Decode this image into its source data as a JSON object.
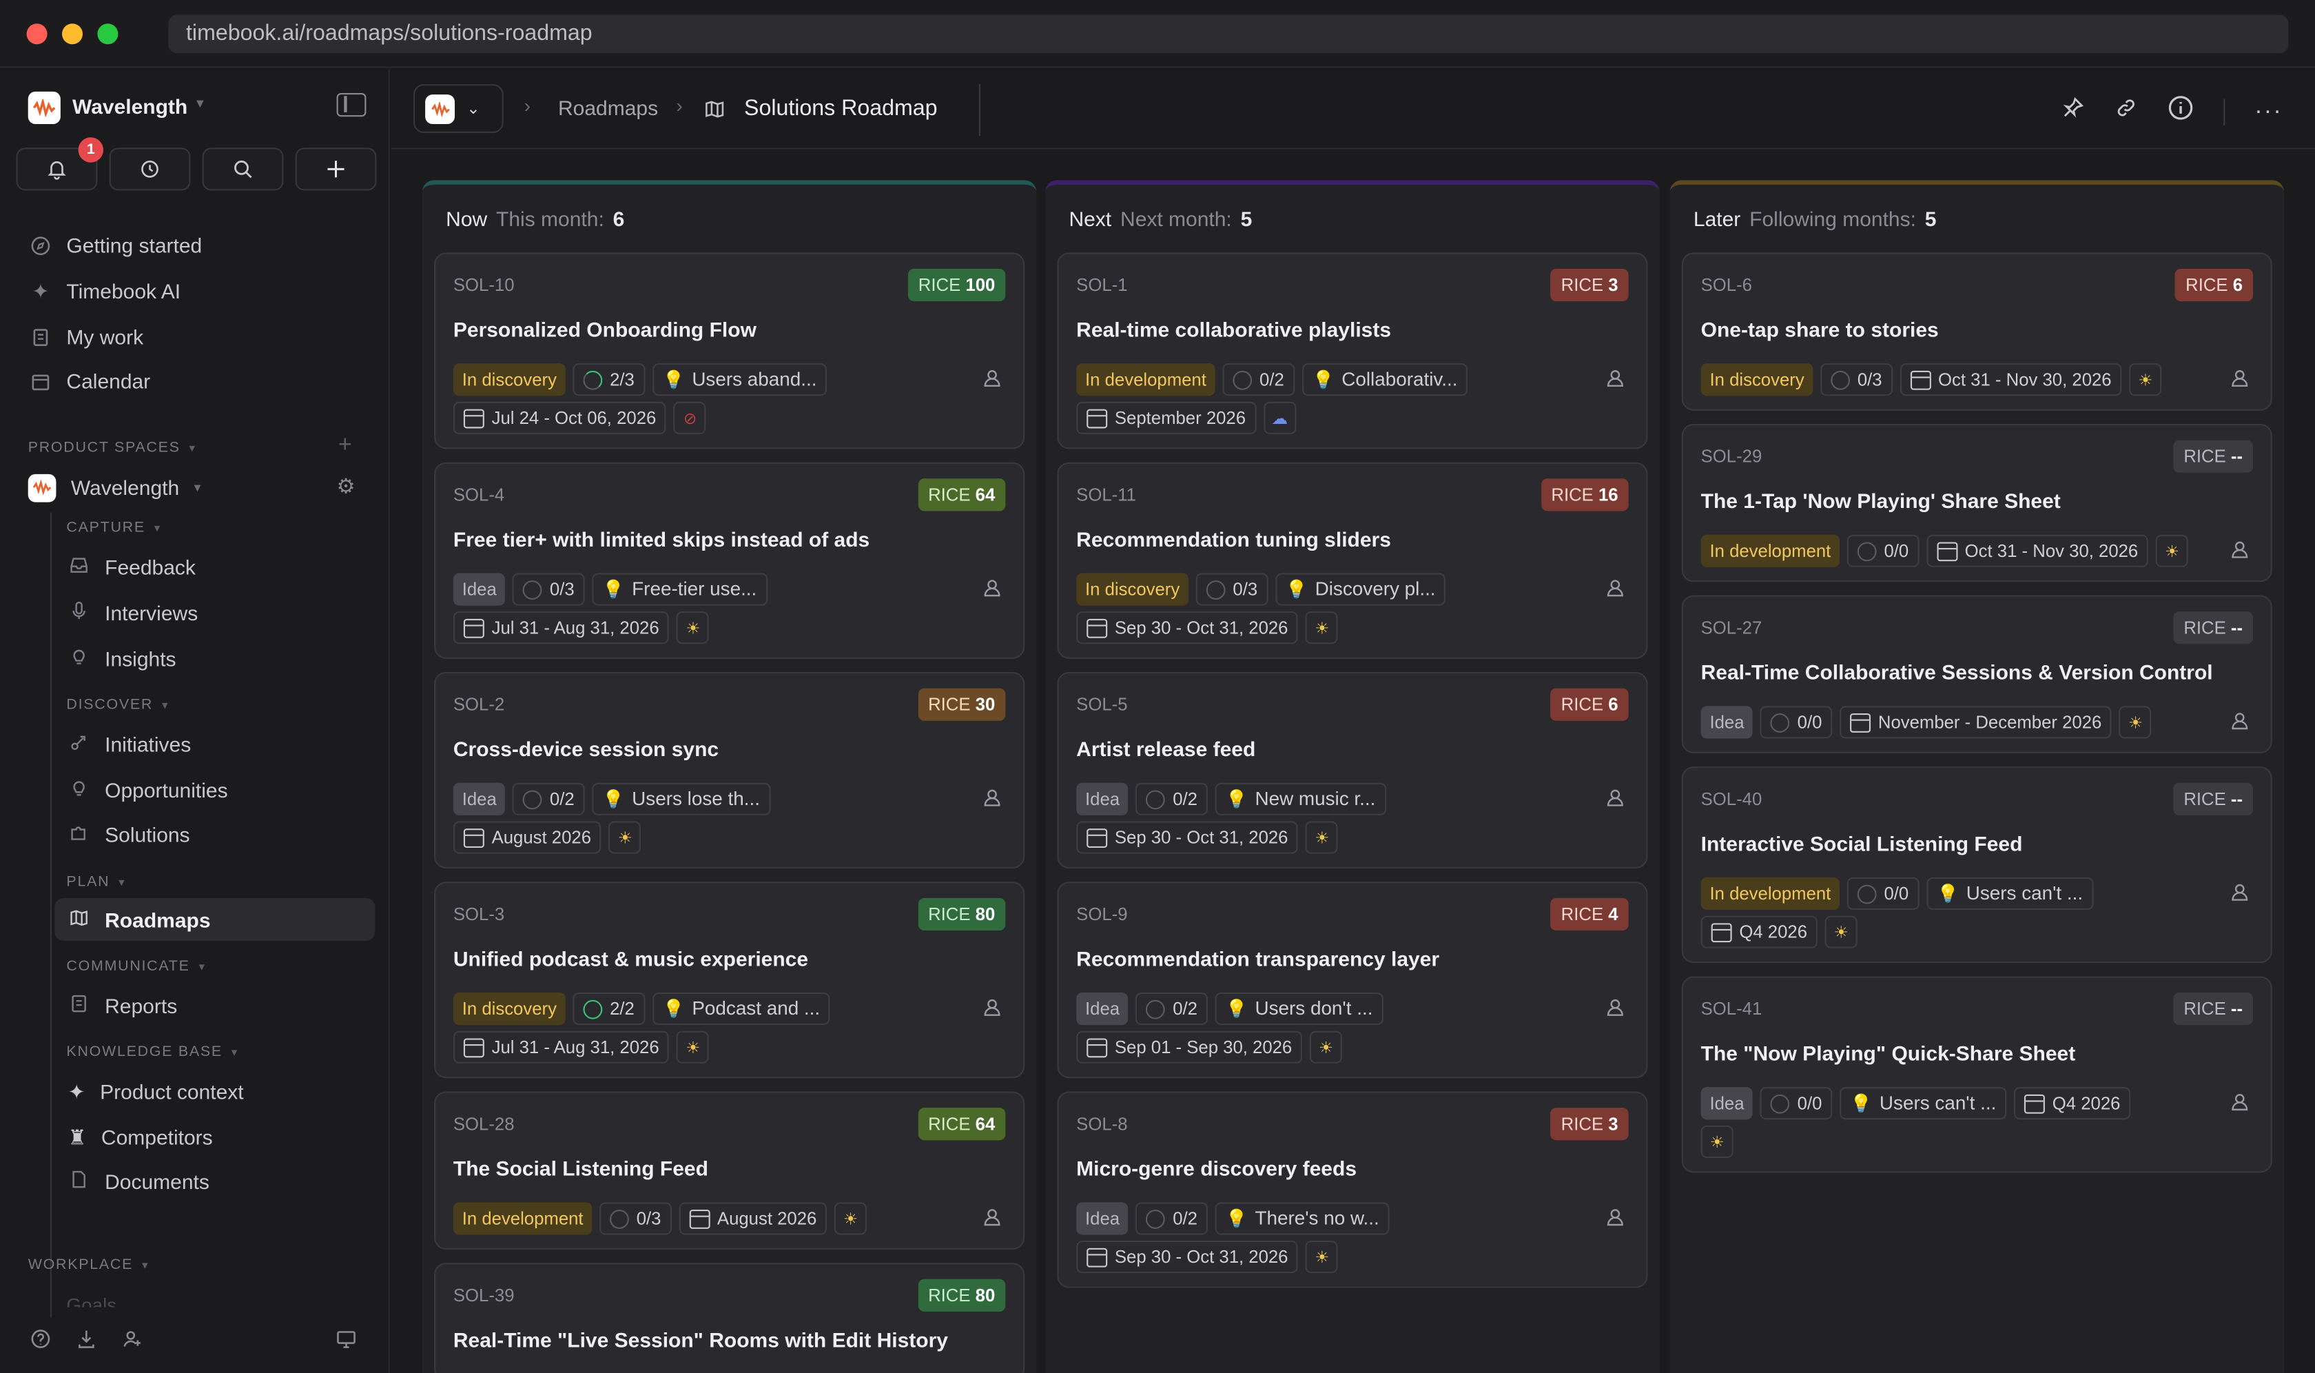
{
  "browser": {
    "url": "timebook.ai/roadmaps/solutions-roadmap"
  },
  "sidebar": {
    "workspace": "Wavelength",
    "notifications_count": "1",
    "nav": [
      {
        "label": "Getting started",
        "icon": "compass-icon"
      },
      {
        "label": "Timebook AI",
        "icon": "sparkle-icon"
      },
      {
        "label": "My work",
        "icon": "clipboard-icon"
      },
      {
        "label": "Calendar",
        "icon": "calendar-icon"
      }
    ],
    "product_spaces_label": "PRODUCT SPACES",
    "space_name": "Wavelength",
    "capture_label": "CAPTURE",
    "capture": [
      "Feedback",
      "Interviews",
      "Insights"
    ],
    "discover_label": "DISCOVER",
    "discover": [
      "Initiatives",
      "Opportunities",
      "Solutions"
    ],
    "plan_label": "PLAN",
    "plan": [
      "Roadmaps"
    ],
    "communicate_label": "COMMUNICATE",
    "communicate": [
      "Reports"
    ],
    "knowledge_label": "KNOWLEDGE BASE",
    "knowledge": [
      "Product context",
      "Competitors",
      "Documents"
    ],
    "workplace_label": "WORKPLACE",
    "workplace_partial": "Goals"
  },
  "header": {
    "crumb_roadmaps": "Roadmaps",
    "title": "Solutions Roadmap"
  },
  "columns": [
    {
      "name": "Now",
      "sub": "This month:",
      "count": "6",
      "accent": "#1f5a55",
      "cards": [
        {
          "id": "SOL-10",
          "rice": "100",
          "rice_color": "green",
          "title": "Personalized Onboarding Flow",
          "status": "In discovery",
          "status_type": "disc",
          "progress": "2/3",
          "prog_type": "partial",
          "opp": "Users aband...",
          "date": "Jul 24 - Oct 06, 2026",
          "extra": "blocked"
        },
        {
          "id": "SOL-4",
          "rice": "64",
          "rice_color": "olive",
          "title": "Free tier+ with limited skips instead of ads",
          "status": "Idea",
          "status_type": "idea",
          "progress": "0/3",
          "prog_type": "empty",
          "opp": "Free-tier use...",
          "date": "Jul 31 - Aug 31, 2026",
          "extra": "sun"
        },
        {
          "id": "SOL-2",
          "rice": "30",
          "rice_color": "amber",
          "title": "Cross-device session sync",
          "status": "Idea",
          "status_type": "idea",
          "progress": "0/2",
          "prog_type": "empty",
          "opp": "Users lose th...",
          "date": "August 2026",
          "extra": "sun"
        },
        {
          "id": "SOL-3",
          "rice": "80",
          "rice_color": "green",
          "title": "Unified podcast & music experience",
          "status": "In discovery",
          "status_type": "disc",
          "progress": "2/2",
          "prog_type": "full",
          "opp": "Podcast and ...",
          "date": "Jul 31 - Aug 31, 2026",
          "extra": "sun"
        },
        {
          "id": "SOL-28",
          "rice": "64",
          "rice_color": "olive",
          "title": "The Social Listening Feed",
          "status": "In development",
          "status_type": "dev",
          "progress": "0/3",
          "prog_type": "empty",
          "opp": "",
          "date": "August 2026",
          "extra": "sun"
        },
        {
          "id": "SOL-39",
          "rice": "80",
          "rice_color": "green",
          "title": "Real-Time \"Live Session\" Rooms with Edit History",
          "status": "",
          "status_type": "",
          "progress": "",
          "prog_type": "",
          "opp": "",
          "date": "",
          "extra": ""
        }
      ]
    },
    {
      "name": "Next",
      "sub": "Next month:",
      "count": "5",
      "accent": "#3e1f6b",
      "cards": [
        {
          "id": "SOL-1",
          "rice": "3",
          "rice_color": "red",
          "title": "Real-time collaborative playlists",
          "status": "In development",
          "status_type": "dev",
          "progress": "0/2",
          "prog_type": "empty",
          "opp": "Collaborativ...",
          "date": "September 2026",
          "extra": "cloud"
        },
        {
          "id": "SOL-11",
          "rice": "16",
          "rice_color": "red",
          "title": "Recommendation tuning sliders",
          "status": "In discovery",
          "status_type": "disc",
          "progress": "0/3",
          "prog_type": "empty",
          "opp": "Discovery pl...",
          "date": "Sep 30 - Oct 31, 2026",
          "extra": "sun"
        },
        {
          "id": "SOL-5",
          "rice": "6",
          "rice_color": "red",
          "title": "Artist release feed",
          "status": "Idea",
          "status_type": "idea",
          "progress": "0/2",
          "prog_type": "empty",
          "opp": "New music r...",
          "date": "Sep 30 - Oct 31, 2026",
          "extra": "sun"
        },
        {
          "id": "SOL-9",
          "rice": "4",
          "rice_color": "red",
          "title": "Recommendation transparency layer",
          "status": "Idea",
          "status_type": "idea",
          "progress": "0/2",
          "prog_type": "empty",
          "opp": "Users don't ...",
          "date": "Sep 01 - Sep 30, 2026",
          "extra": "sun"
        },
        {
          "id": "SOL-8",
          "rice": "3",
          "rice_color": "red",
          "title": "Micro-genre discovery feeds",
          "status": "Idea",
          "status_type": "idea",
          "progress": "0/2",
          "prog_type": "empty",
          "opp": "There's no w...",
          "date": "Sep 30 - Oct 31, 2026",
          "extra": "sun"
        }
      ]
    },
    {
      "name": "Later",
      "sub": "Following months:",
      "count": "5",
      "accent": "#5a4a1c",
      "cards": [
        {
          "id": "SOL-6",
          "rice": "6",
          "rice_color": "red",
          "title": "One-tap share to stories",
          "status": "In discovery",
          "status_type": "disc",
          "progress": "0/3",
          "prog_type": "empty",
          "opp": "",
          "date": "Oct 31 - Nov 30, 2026",
          "extra": "sun"
        },
        {
          "id": "SOL-29",
          "rice": "--",
          "rice_color": "gray",
          "title": "The 1-Tap 'Now Playing' Share Sheet",
          "status": "In development",
          "status_type": "dev",
          "progress": "0/0",
          "prog_type": "empty",
          "opp": "",
          "date": "Oct 31 - Nov 30, 2026",
          "extra": "sun"
        },
        {
          "id": "SOL-27",
          "rice": "--",
          "rice_color": "gray",
          "title": "Real-Time Collaborative Sessions & Version Control",
          "status": "Idea",
          "status_type": "idea",
          "progress": "0/0",
          "prog_type": "empty",
          "opp": "",
          "date": "November - December 2026",
          "extra": "sun"
        },
        {
          "id": "SOL-40",
          "rice": "--",
          "rice_color": "gray",
          "title": "Interactive Social Listening Feed",
          "status": "In development",
          "status_type": "dev",
          "progress": "0/0",
          "prog_type": "empty",
          "opp": "Users can't ...",
          "date": "Q4 2026",
          "extra": "sun"
        },
        {
          "id": "SOL-41",
          "rice": "--",
          "rice_color": "gray",
          "title": "The \"Now Playing\" Quick-Share Sheet",
          "status": "Idea",
          "status_type": "idea",
          "progress": "0/0",
          "prog_type": "empty",
          "opp": "Users can't ...",
          "date": "Q4 2026",
          "extra": "sun"
        }
      ]
    }
  ]
}
